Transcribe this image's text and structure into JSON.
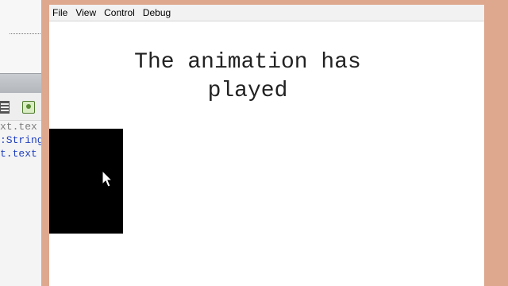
{
  "ide": {
    "code_lines": [
      "xt.tex",
      ":String",
      "t.text"
    ],
    "toolbar_icons": [
      "list-icon",
      "snippet-icon"
    ]
  },
  "player": {
    "menu": [
      "File",
      "View",
      "Control",
      "Debug"
    ],
    "stage": {
      "message_line1": "The animation has",
      "message_line2": "played"
    }
  },
  "colors": {
    "window_frame": "#dea88f",
    "stage_bg": "#ffffff",
    "code_keyword": "#1f3fbf",
    "code_comment": "#7c7c7c",
    "rect": "#000000"
  },
  "cursor": "arrow-cursor"
}
